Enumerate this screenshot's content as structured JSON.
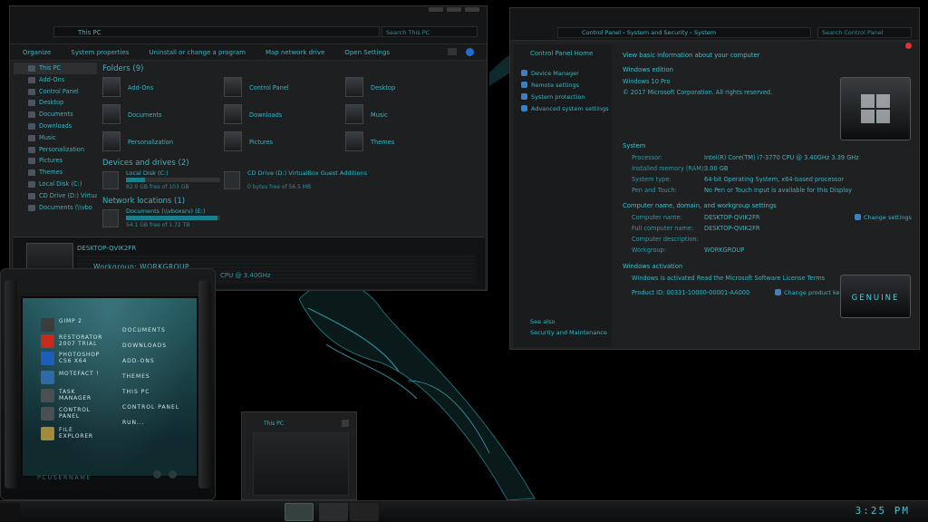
{
  "explorer": {
    "address": "This PC",
    "search_placeholder": "Search This PC",
    "toolbar": [
      "Organize",
      "System properties",
      "Uninstall or change a program",
      "Map network drive",
      "Open Settings"
    ],
    "nav": [
      "This PC",
      "Add-Ons",
      "Control Panel",
      "Desktop",
      "Documents",
      "Downloads",
      "Music",
      "Personalization",
      "Pictures",
      "Themes",
      "Local Disk (C:)",
      "CD Drive (D:) Virtua",
      "Documents (\\\\vbo"
    ],
    "folders_title": "Folders (9)",
    "folders": [
      "Add-Ons",
      "Control Panel",
      "Desktop",
      "Documents",
      "Downloads",
      "Music",
      "Personalization",
      "Pictures",
      "Themes"
    ],
    "devices_title": "Devices and drives (2)",
    "drives": [
      {
        "name": "Local Disk (C:)",
        "free": "82.0 GB free of 103 GB",
        "used_fraction": 0.2
      },
      {
        "name": "CD Drive (D:) VirtualBox Guest Additions",
        "free": "0 bytes free of 56.5 MB",
        "used_fraction": 1.0
      }
    ],
    "network_title": "Network locations (1)",
    "network": [
      {
        "name": "Documents (\\\\vboxsrv) (E:)",
        "free": "54.1 GB free of 1.72 TB",
        "used_fraction": 0.97
      }
    ],
    "details": {
      "pc_name": "DESKTOP-QVIK2FR",
      "workgroup": "Workgroup:   WORKGROUP",
      "cpu": "CPU @ 3.40GHz"
    }
  },
  "system": {
    "search_placeholder": "Search Control Panel",
    "address": "Control Panel   ›   System and Security   ›   System",
    "left": {
      "home": "Control Panel Home",
      "links": [
        "Device Manager",
        "Remote settings",
        "System protection",
        "Advanced system settings"
      ],
      "see_also": "See also",
      "security": "Security and Maintenance"
    },
    "header": "View basic information about your computer",
    "edition_title": "Windows edition",
    "edition": "Windows 10 Pro",
    "copyright": "© 2017 Microsoft Corporation. All rights reserved.",
    "system_title": "System",
    "processor_label": "Processor:",
    "processor": "Intel(R) Core(TM) i7-3770 CPU @ 3.40GHz   3.39 GHz",
    "memory_label": "Installed memory (RAM):",
    "memory": "3.00 GB",
    "type_label": "System type:",
    "type": "64-bit Operating System, x64-based processor",
    "pen_label": "Pen and Touch:",
    "pen": "No Pen or Touch Input is available for this Display",
    "computer_title": "Computer name, domain, and workgroup settings",
    "cname_label": "Computer name:",
    "cname": "DESKTOP-QVIK2FR",
    "fullname_label": "Full computer name:",
    "fullname": "DESKTOP-QVIK2FR",
    "desc_label": "Computer description:",
    "workgroup_label": "Workgroup:",
    "workgroup": "WORKGROUP",
    "change_settings": "Change settings",
    "activation_title": "Windows activation",
    "activated": "Windows is activated   Read the Microsoft Software License Terms",
    "product_id": "Product ID: 00331-10000-00001-AA000",
    "change_key": "Change product key",
    "genuine": "GENUINE"
  },
  "startmenu": {
    "pinned": [
      {
        "label": "GIMP 2",
        "color": "#3c3c3c"
      },
      {
        "label": "RESTORATOR\n2007 TRIAL",
        "color": "#c62a1d"
      },
      {
        "label": "PHOTOSHOP\nCS6 X64",
        "color": "#1d5fb8"
      },
      {
        "label": "MOTEFACT !",
        "color": "#2f6aa8"
      },
      {
        "label": "TASK\nMANAGER",
        "color": "#4a4f52"
      },
      {
        "label": "CONTROL\nPANEL",
        "color": "#4a4f52"
      },
      {
        "label": "FILE\nEXPLORER",
        "color": "#a38a38"
      }
    ],
    "places": [
      "DOCUMENTS",
      "DOWNLOADS",
      "ADD-ONS",
      "THEMES",
      "THIS PC",
      "CONTROL PANEL",
      "RUN..."
    ],
    "user": "PCUSERNAME"
  },
  "preview": {
    "title": "This PC"
  },
  "taskbar": {
    "clock": "3:25 PM"
  }
}
